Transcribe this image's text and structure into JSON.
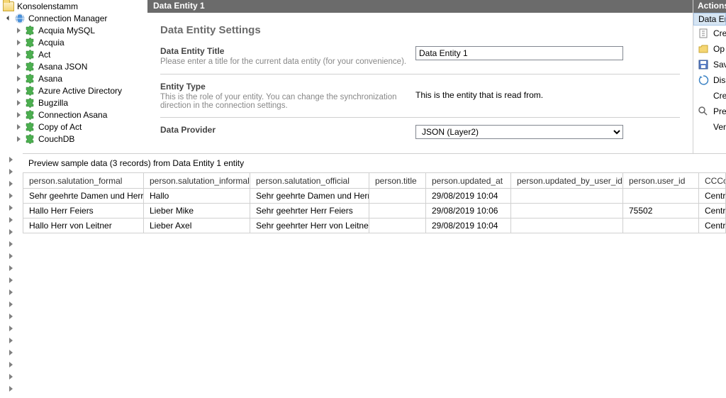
{
  "tree": {
    "root": "Konsolenstamm",
    "manager": "Connection Manager",
    "items": [
      "Acquia MySQL",
      "Acquia",
      "Act",
      "Asana JSON",
      "Asana",
      "Azure Active Directory",
      "Bugzilla",
      "Connection Asana",
      "Copy of Act",
      "CouchDB"
    ]
  },
  "main": {
    "header": "Data Entity 1",
    "title": "Data Entity Settings",
    "entity_title_label": "Data Entity Title",
    "entity_title_desc": "Please enter a title for the current data entity (for your convenience).",
    "entity_title_value": "Data Entity 1",
    "entity_type_label": "Entity Type",
    "entity_type_desc": "This is the role of your entity. You can change the synchronization direction in the connection settings.",
    "entity_type_value": "This is the entity that is read from.",
    "provider_label": "Data Provider",
    "provider_value": "JSON (Layer2)"
  },
  "actions": {
    "header": "Actions",
    "subheader": "Data En",
    "items": [
      "Cre",
      "Op",
      "Sav",
      "Dis",
      "Cre",
      "Pre",
      "Ver"
    ]
  },
  "preview": {
    "header": "Preview sample data (3 records) from Data Entity 1 entity",
    "columns": [
      "person.salutation_formal",
      "person.salutation_informal",
      "person.salutation_official",
      "person.title",
      "person.updated_at",
      "person.updated_by_user_id",
      "person.user_id",
      "CCCo"
    ],
    "rows": [
      [
        "Sehr geehrte Damen und Herren",
        "Hallo",
        "Sehr geehrte Damen und Herren",
        "",
        "29/08/2019 10:04",
        "",
        "",
        "Centra"
      ],
      [
        "Hallo Herr Feiers",
        "Lieber Mike",
        "Sehr geehrter Herr Feiers",
        "",
        "29/08/2019 10:06",
        "",
        "75502",
        "Centra"
      ],
      [
        "Hallo Herr von Leitner",
        "Lieber Axel",
        "Sehr geehrter Herr von Leitner",
        "",
        "29/08/2019 10:04",
        "",
        "",
        "Centra"
      ]
    ]
  }
}
